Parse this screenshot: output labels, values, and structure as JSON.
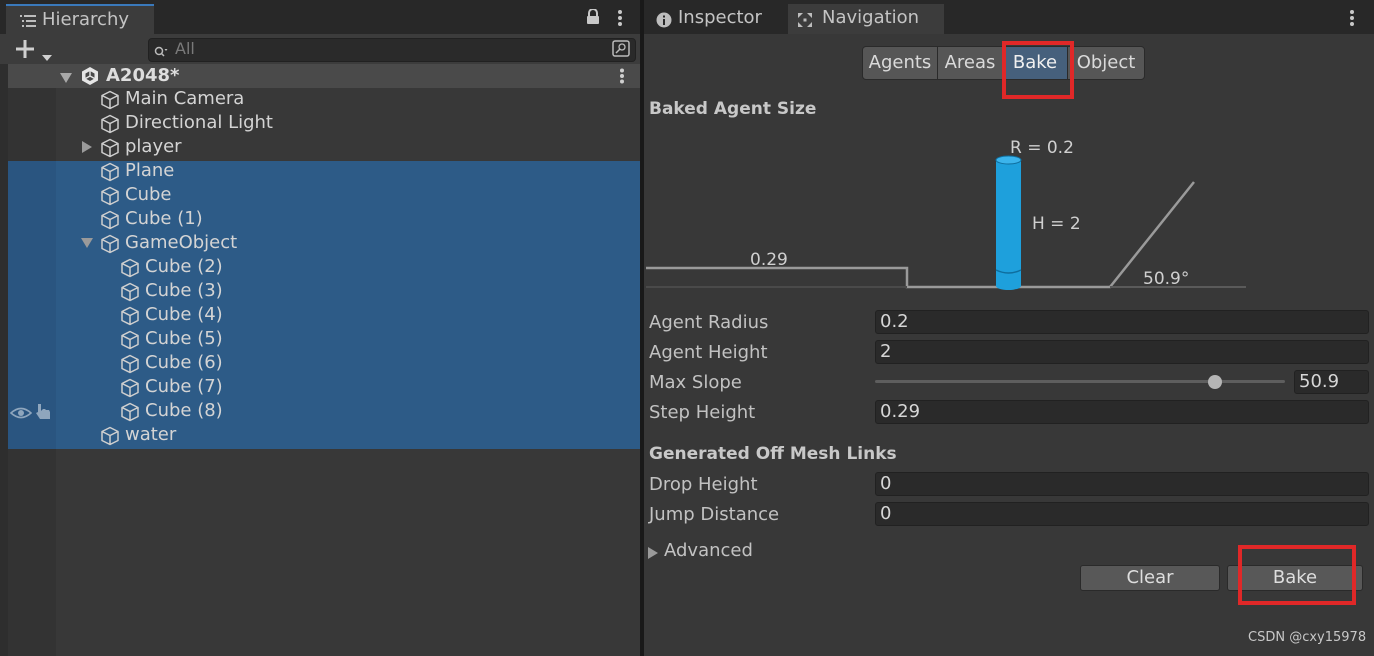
{
  "hierarchy": {
    "tab_title": "Hierarchy",
    "search_placeholder": "All",
    "scene_name": "A2048*",
    "items": [
      {
        "name": "Main Camera"
      },
      {
        "name": "Directional Light"
      },
      {
        "name": "player",
        "collapsed": true
      },
      {
        "name": "Plane",
        "selected": true
      },
      {
        "name": "Cube",
        "selected": true
      },
      {
        "name": "Cube (1)",
        "selected": true
      },
      {
        "name": "GameObject",
        "selected": true,
        "expanded": true
      },
      {
        "name": "Cube (2)",
        "selected": true,
        "child": true
      },
      {
        "name": "Cube (3)",
        "selected": true,
        "child": true
      },
      {
        "name": "Cube (4)",
        "selected": true,
        "child": true
      },
      {
        "name": "Cube (5)",
        "selected": true,
        "child": true
      },
      {
        "name": "Cube (6)",
        "selected": true,
        "child": true
      },
      {
        "name": "Cube (7)",
        "selected": true,
        "child": true
      },
      {
        "name": "Cube (8)",
        "selected": true,
        "child": true
      },
      {
        "name": "water",
        "selected": true
      }
    ]
  },
  "navigation": {
    "tabs": {
      "inspector": "Inspector",
      "navigation": "Navigation"
    },
    "segments": {
      "agents": "Agents",
      "areas": "Areas",
      "bake": "Bake",
      "object": "Object",
      "active": "Bake"
    },
    "baked_agent_size": {
      "title": "Baked Agent Size",
      "radius_label": "R = 0.2",
      "height_label": "H = 2",
      "step_label": "0.29",
      "slope_label": "50.9°"
    },
    "props": {
      "agent_radius": {
        "label": "Agent Radius",
        "value": "0.2"
      },
      "agent_height": {
        "label": "Agent Height",
        "value": "2"
      },
      "max_slope": {
        "label": "Max Slope",
        "value": "50.9",
        "slider_fraction": 0.83
      },
      "step_height": {
        "label": "Step Height",
        "value": "0.29"
      }
    },
    "offmesh": {
      "title": "Generated Off Mesh Links",
      "drop_height": {
        "label": "Drop Height",
        "value": "0"
      },
      "jump_distance": {
        "label": "Jump Distance",
        "value": "0"
      }
    },
    "advanced_label": "Advanced",
    "buttons": {
      "clear": "Clear",
      "bake": "Bake"
    }
  },
  "watermark": "CSDN @cxy15978",
  "colors": {
    "selection": "#2d5b87",
    "highlight": "#e02828",
    "agent": "#1ea0dc"
  }
}
